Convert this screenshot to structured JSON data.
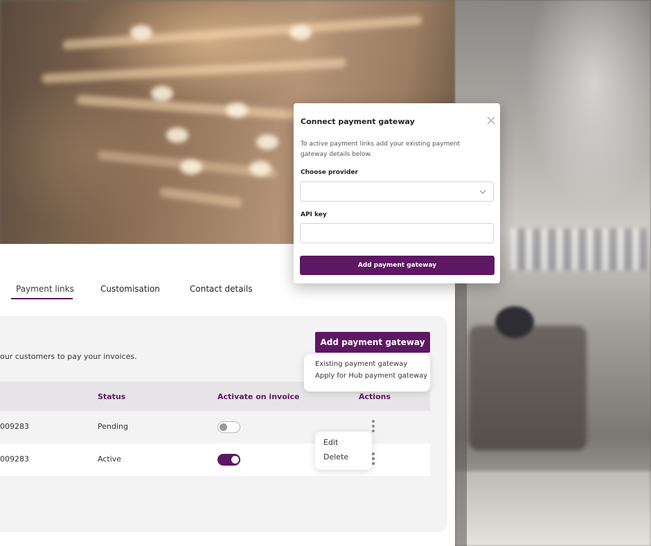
{
  "tabs": [
    {
      "label": "Payment links",
      "active": true
    },
    {
      "label": "Customisation",
      "active": false
    },
    {
      "label": "Contact details",
      "active": false
    }
  ],
  "description": "our customers to pay your invoices.",
  "add_gateway_button": "Add payment gateway",
  "add_gateway_menu": [
    "Existing payment gateway",
    "Apply for Hub payment gateway"
  ],
  "table": {
    "headers": {
      "status": "Status",
      "activate": "Activate on invoice",
      "actions": "Actions"
    },
    "rows": [
      {
        "id": "009283",
        "status": "Pending",
        "activated": false
      },
      {
        "id": "009283",
        "status": "Active",
        "activated": true
      }
    ]
  },
  "row_menu": [
    "Edit",
    "Delete"
  ],
  "modal": {
    "title": "Connect payment gateway",
    "description": "To active payment links add your existing payment gateway details below.",
    "provider_label": "Choose provider",
    "provider_value": "",
    "api_key_label": "API key",
    "api_key_value": "",
    "submit_label": "Add payment gateway"
  },
  "colors": {
    "brand": "#5e1763",
    "table_header_bg": "#e6e4e7",
    "card_bg": "#f3f3f4"
  },
  "icons": [
    "close-icon",
    "chevron-down-icon",
    "kebab-menu-icon"
  ]
}
